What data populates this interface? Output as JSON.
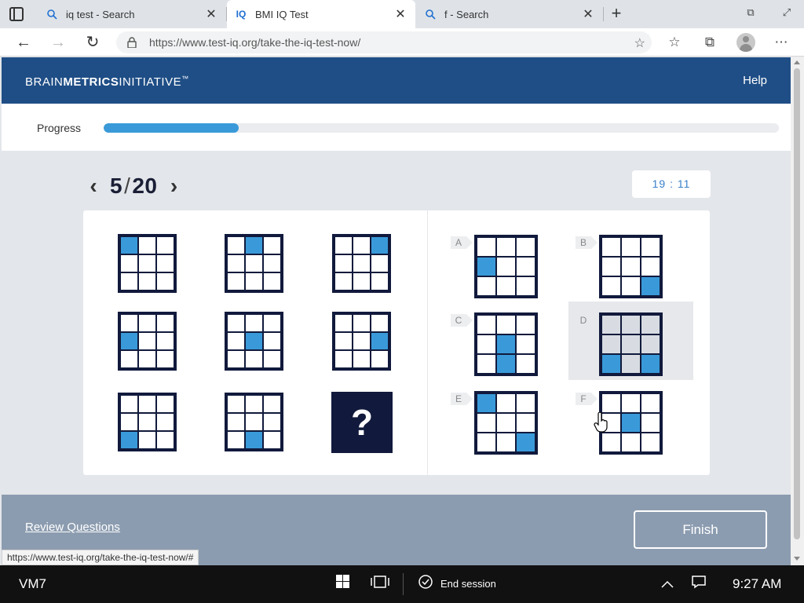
{
  "browser": {
    "tabs": [
      {
        "title": "iq test - Search",
        "favicon": "search-icon",
        "active": false
      },
      {
        "title": "BMI IQ Test",
        "favicon": "IQ",
        "active": true
      },
      {
        "title": "f - Search",
        "favicon": "search-icon",
        "active": false
      }
    ],
    "url": "https://www.test-iq.org/take-the-iq-test-now/",
    "status_url": "https://www.test-iq.org/take-the-iq-test-now/#"
  },
  "header": {
    "brand_part1": "BRAIN",
    "brand_part2": "METRICS",
    "brand_part3": "INITIATIVE",
    "brand_tm": "™",
    "help": "Help"
  },
  "progress": {
    "label": "Progress",
    "fraction": 0.2
  },
  "question": {
    "current": "5",
    "separator": "/",
    "total": "20",
    "timer": "19 : 11",
    "mystery": "?"
  },
  "matrix": [
    [
      0
    ],
    [
      1
    ],
    [
      2
    ],
    [
      3
    ],
    [
      4
    ],
    [
      5
    ],
    [
      6
    ],
    [
      7
    ],
    null
  ],
  "options": [
    {
      "letter": "A",
      "cells": [
        3
      ]
    },
    {
      "letter": "B",
      "cells": [
        8
      ]
    },
    {
      "letter": "C",
      "cells": [
        4,
        7
      ]
    },
    {
      "letter": "D",
      "cells": [
        6,
        8
      ],
      "hovered": true
    },
    {
      "letter": "E",
      "cells": [
        0,
        8
      ]
    },
    {
      "letter": "F",
      "cells": [
        4
      ]
    }
  ],
  "footer": {
    "review": "Review Questions",
    "finish": "Finish"
  },
  "taskbar": {
    "vm": "VM7",
    "end_session": "End session",
    "clock": "9:27 AM"
  },
  "colors": {
    "header": "#1f4e86",
    "accent": "#3a9ad9",
    "grid_border": "#111a3c",
    "footer": "#8c9cb0"
  }
}
